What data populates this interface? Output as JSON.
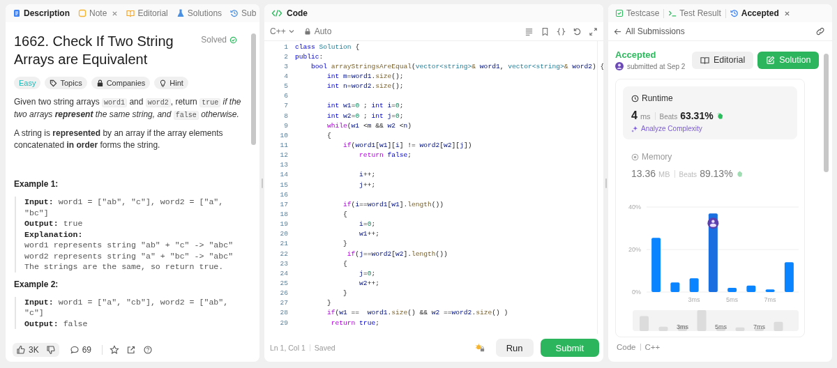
{
  "left_panel": {
    "tabs": [
      {
        "label": "Description",
        "kind": "description",
        "selected": true,
        "closable": false
      },
      {
        "label": "Note",
        "kind": "note",
        "selected": false,
        "closable": true
      },
      {
        "label": "Editorial",
        "kind": "editorial",
        "selected": false,
        "closable": false
      },
      {
        "label": "Solutions",
        "kind": "solutions",
        "selected": false,
        "closable": false
      },
      {
        "label": "Sub",
        "kind": "submissions",
        "selected": false,
        "closable": false
      }
    ],
    "problem": {
      "title": "1662. Check If Two String Arrays are Equivalent",
      "status": "Solved",
      "solved": true,
      "tags": [
        {
          "label": "Easy",
          "kind": "difficulty"
        },
        {
          "label": "Topics",
          "kind": "topics"
        },
        {
          "label": "Companies",
          "kind": "companies"
        },
        {
          "label": "Hint",
          "kind": "hint"
        }
      ],
      "paragraphs": [
        [
          {
            "t": "Given two string arrays ",
            "kind": "plain"
          },
          {
            "t": "word1",
            "kind": "code"
          },
          {
            "t": " and ",
            "kind": "plain"
          },
          {
            "t": "word2",
            "kind": "code"
          },
          {
            "t": ", return ",
            "kind": "plain"
          },
          {
            "t": "true",
            "kind": "code"
          },
          {
            "t": " if the two arrays ",
            "kind": "italic"
          },
          {
            "t": "represent",
            "kind": "bold-italic"
          },
          {
            "t": " the same string, and ",
            "kind": "italic"
          },
          {
            "t": "false",
            "kind": "code"
          },
          {
            "t": " otherwise.",
            "kind": "italic"
          }
        ],
        [
          {
            "t": "A string is ",
            "kind": "plain"
          },
          {
            "t": "represented",
            "kind": "bold"
          },
          {
            "t": " by an array if the array elements concatenated ",
            "kind": "plain"
          },
          {
            "t": "in order",
            "kind": "bold"
          },
          {
            "t": " forms the string.",
            "kind": "plain"
          }
        ]
      ],
      "examples": [
        {
          "heading": "Example 1:",
          "lines": [
            "**Input:** word1 = [\"ab\", \"c\"], word2 = [\"a\", \"bc\"]",
            "**Output:** true",
            "**Explanation:**",
            "word1 represents string \"ab\" + \"c\" -> \"abc\"",
            "word2 represents string \"a\" + \"bc\" -> \"abc\"",
            "The strings are the same, so return true."
          ]
        },
        {
          "heading": "Example 2:",
          "lines": [
            "**Input:** word1 = [\"a\", \"cb\"], word2 = [\"ab\", \"c\"]",
            "**Output:** false"
          ]
        }
      ]
    },
    "footer": {
      "likes": "3K",
      "comments": "69"
    }
  },
  "code_panel": {
    "title": "Code",
    "language": "C++",
    "mode": "Auto",
    "lines": [
      {
        "n": "1",
        "segs": [
          {
            "kind": "kw",
            "t": "class"
          },
          {
            "kind": "ty",
            "t": " Solution"
          },
          {
            "kind": "p",
            "t": " {"
          }
        ]
      },
      {
        "n": "2",
        "segs": [
          {
            "kind": "kw",
            "t": "public"
          },
          {
            "kind": "p",
            "t": ":"
          }
        ]
      },
      {
        "n": "3",
        "segs": [
          {
            "kind": "kw",
            "t": "    bool"
          },
          {
            "kind": "fn",
            "t": " arrayStringsAreEqual"
          },
          {
            "kind": "p",
            "t": "("
          },
          {
            "kind": "ty",
            "t": "vector<string>"
          },
          {
            "kind": "op",
            "t": "&"
          },
          {
            "kind": "id",
            "t": " word1"
          },
          {
            "kind": "p",
            "t": ", "
          },
          {
            "kind": "ty",
            "t": "vector<string>"
          },
          {
            "kind": "op",
            "t": "&"
          },
          {
            "kind": "id",
            "t": " word2"
          },
          {
            "kind": "p",
            "t": ") {"
          }
        ]
      },
      {
        "n": "4",
        "segs": [
          {
            "kind": "kw",
            "t": "        int"
          },
          {
            "kind": "id",
            "t": " m"
          },
          {
            "kind": "p",
            "t": "="
          },
          {
            "kind": "id",
            "t": "word1"
          },
          {
            "kind": "p",
            "t": "."
          },
          {
            "kind": "fn",
            "t": "size"
          },
          {
            "kind": "p",
            "t": "();"
          }
        ]
      },
      {
        "n": "5",
        "segs": [
          {
            "kind": "kw",
            "t": "        int"
          },
          {
            "kind": "id",
            "t": " n"
          },
          {
            "kind": "p",
            "t": "="
          },
          {
            "kind": "id",
            "t": "word2"
          },
          {
            "kind": "p",
            "t": "."
          },
          {
            "kind": "fn",
            "t": "size"
          },
          {
            "kind": "p",
            "t": "();"
          }
        ]
      },
      {
        "n": "6"
      },
      {
        "n": "7",
        "segs": [
          {
            "kind": "kw",
            "t": "        int"
          },
          {
            "kind": "id",
            "t": " w1"
          },
          {
            "kind": "p",
            "t": "="
          },
          {
            "kind": "num",
            "t": "0"
          },
          {
            "kind": "p",
            "t": " ; "
          },
          {
            "kind": "kw",
            "t": "int"
          },
          {
            "kind": "id",
            "t": " i"
          },
          {
            "kind": "p",
            "t": "="
          },
          {
            "kind": "num",
            "t": "0"
          },
          {
            "kind": "p",
            "t": ";"
          }
        ]
      },
      {
        "n": "8",
        "segs": [
          {
            "kind": "kw",
            "t": "        int"
          },
          {
            "kind": "id",
            "t": " w2"
          },
          {
            "kind": "p",
            "t": "="
          },
          {
            "kind": "num",
            "t": "0"
          },
          {
            "kind": "p",
            "t": " ; "
          },
          {
            "kind": "kw",
            "t": "int"
          },
          {
            "kind": "id",
            "t": " j"
          },
          {
            "kind": "p",
            "t": "="
          },
          {
            "kind": "num",
            "t": "0"
          },
          {
            "kind": "p",
            "t": ";"
          }
        ]
      },
      {
        "n": "9",
        "segs": [
          {
            "kind": "ctl",
            "t": "        while"
          },
          {
            "kind": "p",
            "t": "("
          },
          {
            "kind": "id",
            "t": "w1"
          },
          {
            "kind": "p",
            "t": " <"
          },
          {
            "kind": "id",
            "t": "m"
          },
          {
            "kind": "p",
            "t": " && "
          },
          {
            "kind": "id",
            "t": "w2"
          },
          {
            "kind": "p",
            "t": " <"
          },
          {
            "kind": "id",
            "t": "n"
          },
          {
            "kind": "p",
            "t": ")"
          }
        ]
      },
      {
        "n": "10",
        "segs": [
          {
            "kind": "p",
            "t": "        {"
          }
        ]
      },
      {
        "n": "11",
        "segs": [
          {
            "kind": "ctl",
            "t": "            if"
          },
          {
            "kind": "p",
            "t": "("
          },
          {
            "kind": "id",
            "t": "word1"
          },
          {
            "kind": "p",
            "t": "["
          },
          {
            "kind": "id",
            "t": "w1"
          },
          {
            "kind": "p",
            "t": "]["
          },
          {
            "kind": "id",
            "t": "i"
          },
          {
            "kind": "p",
            "t": "] != "
          },
          {
            "kind": "id",
            "t": "word2"
          },
          {
            "kind": "p",
            "t": "["
          },
          {
            "kind": "id",
            "t": "w2"
          },
          {
            "kind": "p",
            "t": "]["
          },
          {
            "kind": "id",
            "t": "j"
          },
          {
            "kind": "p",
            "t": "])"
          }
        ]
      },
      {
        "n": "12",
        "segs": [
          {
            "kind": "ctl",
            "t": "                return"
          },
          {
            "kind": "kw",
            "t": " false"
          },
          {
            "kind": "p",
            "t": ";"
          }
        ]
      },
      {
        "n": "13"
      },
      {
        "n": "14",
        "segs": [
          {
            "kind": "id",
            "t": "                i"
          },
          {
            "kind": "p",
            "t": "++;"
          }
        ]
      },
      {
        "n": "15",
        "segs": [
          {
            "kind": "id",
            "t": "                j"
          },
          {
            "kind": "p",
            "t": "++;"
          }
        ]
      },
      {
        "n": "16"
      },
      {
        "n": "17",
        "segs": [
          {
            "kind": "ctl",
            "t": "            if"
          },
          {
            "kind": "p",
            "t": "("
          },
          {
            "kind": "id",
            "t": "i"
          },
          {
            "kind": "p",
            "t": "=="
          },
          {
            "kind": "id",
            "t": "word1"
          },
          {
            "kind": "p",
            "t": "["
          },
          {
            "kind": "id",
            "t": "w1"
          },
          {
            "kind": "p",
            "t": "]."
          },
          {
            "kind": "fn",
            "t": "length"
          },
          {
            "kind": "p",
            "t": "())"
          }
        ]
      },
      {
        "n": "18",
        "segs": [
          {
            "kind": "p",
            "t": "            {"
          }
        ]
      },
      {
        "n": "19",
        "segs": [
          {
            "kind": "id",
            "t": "                i"
          },
          {
            "kind": "p",
            "t": "="
          },
          {
            "kind": "num",
            "t": "0"
          },
          {
            "kind": "p",
            "t": ";"
          }
        ]
      },
      {
        "n": "20",
        "segs": [
          {
            "kind": "id",
            "t": "                w1"
          },
          {
            "kind": "p",
            "t": "++;"
          }
        ]
      },
      {
        "n": "21",
        "segs": [
          {
            "kind": "p",
            "t": "            }"
          }
        ]
      },
      {
        "n": "22",
        "segs": [
          {
            "kind": "ctl",
            "t": "             if"
          },
          {
            "kind": "p",
            "t": "("
          },
          {
            "kind": "id",
            "t": "j"
          },
          {
            "kind": "p",
            "t": "=="
          },
          {
            "kind": "id",
            "t": "word2"
          },
          {
            "kind": "p",
            "t": "["
          },
          {
            "kind": "id",
            "t": "w2"
          },
          {
            "kind": "p",
            "t": "]."
          },
          {
            "kind": "fn",
            "t": "length"
          },
          {
            "kind": "p",
            "t": "())"
          }
        ]
      },
      {
        "n": "23",
        "segs": [
          {
            "kind": "p",
            "t": "            {"
          }
        ]
      },
      {
        "n": "24",
        "segs": [
          {
            "kind": "id",
            "t": "                j"
          },
          {
            "kind": "p",
            "t": "="
          },
          {
            "kind": "num",
            "t": "0"
          },
          {
            "kind": "p",
            "t": ";"
          }
        ]
      },
      {
        "n": "25",
        "segs": [
          {
            "kind": "id",
            "t": "                w2"
          },
          {
            "kind": "p",
            "t": "++;"
          }
        ]
      },
      {
        "n": "26",
        "segs": [
          {
            "kind": "p",
            "t": "            }"
          }
        ]
      },
      {
        "n": "27",
        "segs": [
          {
            "kind": "p",
            "t": "        }"
          }
        ]
      },
      {
        "n": "28",
        "segs": [
          {
            "kind": "ctl",
            "t": "        if"
          },
          {
            "kind": "p",
            "t": "("
          },
          {
            "kind": "id",
            "t": "w1"
          },
          {
            "kind": "p",
            "t": " ==  "
          },
          {
            "kind": "id",
            "t": "word1"
          },
          {
            "kind": "p",
            "t": "."
          },
          {
            "kind": "fn",
            "t": "size"
          },
          {
            "kind": "p",
            "t": "() && "
          },
          {
            "kind": "id",
            "t": "w2"
          },
          {
            "kind": "p",
            "t": " =="
          },
          {
            "kind": "id",
            "t": "word2"
          },
          {
            "kind": "p",
            "t": "."
          },
          {
            "kind": "fn",
            "t": "size"
          },
          {
            "kind": "p",
            "t": "() )"
          }
        ]
      },
      {
        "n": "29",
        "segs": [
          {
            "kind": "ctl",
            "t": "         return"
          },
          {
            "kind": "kw",
            "t": " true"
          },
          {
            "kind": "p",
            "t": ";"
          }
        ]
      }
    ],
    "status": {
      "position": "Ln 1, Col 1",
      "saved": "Saved"
    },
    "buttons": [
      {
        "label": "Run",
        "kind": "secondary"
      },
      {
        "label": "Submit",
        "kind": "primary"
      }
    ]
  },
  "result_panel": {
    "tabs": [
      {
        "label": "Testcase",
        "kind": "testcase",
        "selected": false,
        "closable": false
      },
      {
        "label": "Test Result",
        "kind": "result",
        "selected": false,
        "closable": false
      },
      {
        "label": "Accepted",
        "kind": "submission",
        "selected": true,
        "closable": true
      }
    ],
    "back_link": "All Submissions",
    "verdict": "Accepted",
    "submitted": "submitted at Sep 2",
    "buttons": [
      {
        "label": "Editorial",
        "kind": "secondary"
      },
      {
        "label": "Solution",
        "kind": "primary"
      }
    ],
    "runtime": {
      "label": "Runtime",
      "value": "4",
      "unit": "ms",
      "beats_label": "Beats",
      "beats": "63.31%",
      "analyze": "Analyze Complexity"
    },
    "memory": {
      "label": "Memory",
      "value": "13.36",
      "unit": "MB",
      "beats_label": "Beats",
      "beats": "89.13%"
    },
    "chart_data": {
      "type": "bar",
      "categories": [
        null,
        null,
        "3ms",
        null,
        "5ms",
        null,
        "7ms",
        null
      ],
      "values": [
        25.5,
        4.5,
        6.5,
        37,
        2,
        3,
        1.2,
        14
      ],
      "ylim": [
        0,
        40
      ],
      "yticks": [
        {
          "value": 0,
          "label": "0%"
        },
        {
          "value": 20,
          "label": "20%"
        },
        {
          "value": 40,
          "label": "40%"
        }
      ]
    },
    "overview": {
      "labels": [
        "3ms",
        "5ms",
        "7ms"
      ]
    },
    "code_footer": {
      "label": "Code",
      "language": "C++"
    }
  }
}
